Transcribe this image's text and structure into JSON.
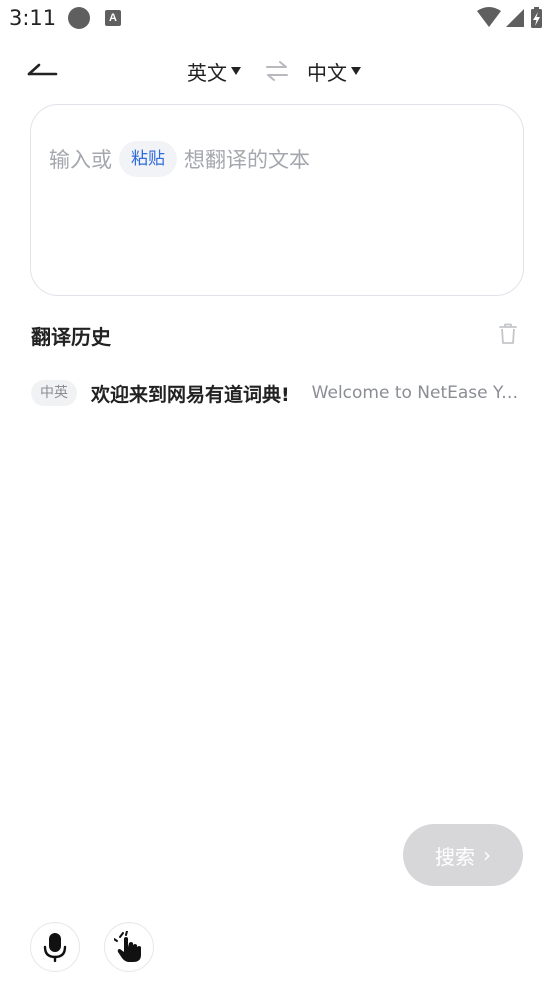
{
  "status_bar": {
    "time": "3:11",
    "a_icon": "A"
  },
  "toolbar": {
    "source_language": "英文",
    "target_language": "中文",
    "back_icon": "arrow-left-icon",
    "swap_icon": "swap-arrows-icon"
  },
  "input": {
    "placeholder_before": "输入或",
    "paste_label": "粘贴",
    "placeholder_after": "想翻译的文本"
  },
  "history": {
    "title": "翻译历史",
    "clear_icon": "trash-icon",
    "items": [
      {
        "lang_pair": "中英",
        "source": "欢迎来到网易有道词典!",
        "target": "Welcome to NetEase Youdao Dictionary!"
      }
    ]
  },
  "search_button": {
    "label": "搜索",
    "chevron": "›"
  },
  "bottom_buttons": {
    "voice_icon": "microphone-icon",
    "gesture_icon": "tap-hand-icon"
  },
  "colors": {
    "accent": "#2f6bdb",
    "search_disabled_bg": "#d7d7d9",
    "placeholder": "#a4a7ad",
    "border": "#e1e3ea"
  }
}
